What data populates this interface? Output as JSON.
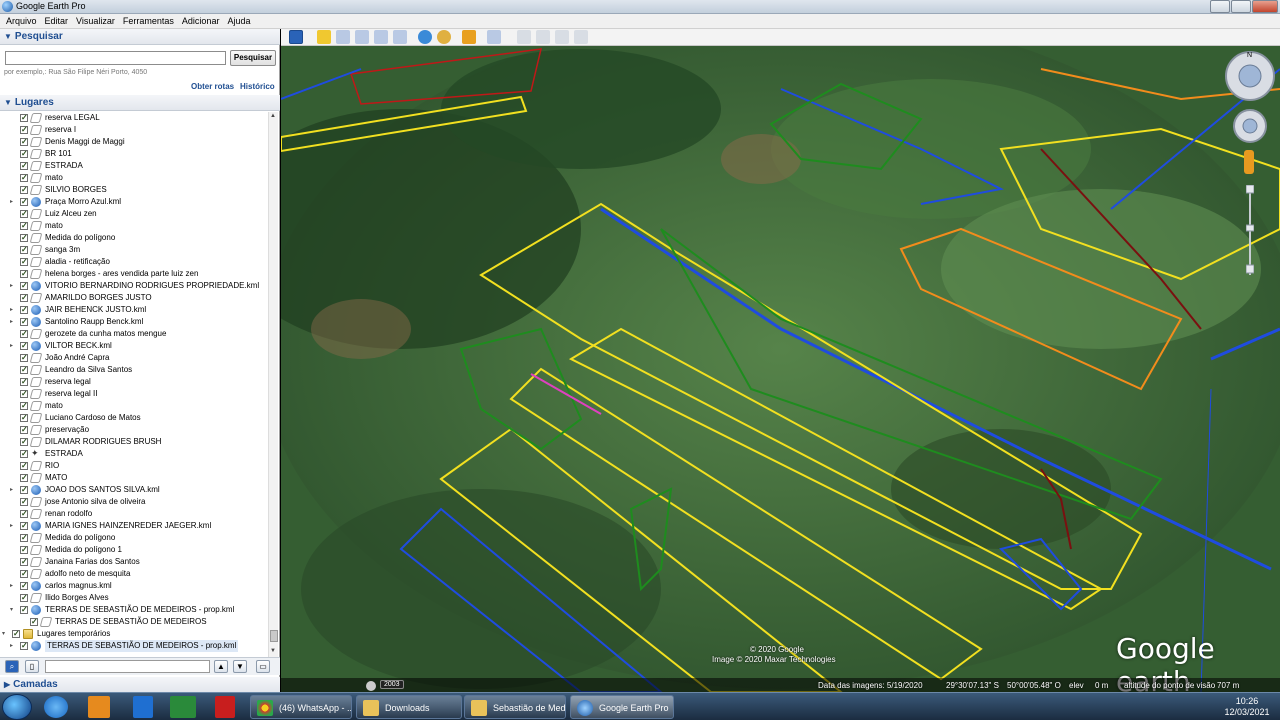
{
  "window": {
    "title": "Google Earth Pro",
    "app_icon": "google-earth-icon"
  },
  "menu": [
    "Arquivo",
    "Editar",
    "Visualizar",
    "Ferramentas",
    "Adicionar",
    "Ajuda"
  ],
  "search": {
    "header": "Pesquisar",
    "value": "",
    "button": "Pesquisar",
    "hint": "por exemplo,: Rua São Filipe Néri Porto, 4050",
    "link_routes": "Obter rotas",
    "link_history": "Histórico"
  },
  "places": {
    "header": "Lugares",
    "items": [
      {
        "label": "reserva LEGAL",
        "icon": "path",
        "exp": ""
      },
      {
        "label": "reserva I",
        "icon": "path",
        "exp": ""
      },
      {
        "label": "Denis Maggi de Maggi",
        "icon": "path",
        "exp": ""
      },
      {
        "label": "BR 101",
        "icon": "path",
        "exp": ""
      },
      {
        "label": "ESTRADA",
        "icon": "path",
        "exp": ""
      },
      {
        "label": "mato",
        "icon": "path",
        "exp": ""
      },
      {
        "label": "SILVIO BORGES",
        "icon": "path",
        "exp": ""
      },
      {
        "label": "Praça Morro Azul.kml",
        "icon": "globe",
        "exp": "▸"
      },
      {
        "label": "Luiz Alceu zen",
        "icon": "path",
        "exp": ""
      },
      {
        "label": "mato",
        "icon": "path",
        "exp": ""
      },
      {
        "label": "Medida do polígono",
        "icon": "path",
        "exp": ""
      },
      {
        "label": "sanga 3m",
        "icon": "path",
        "exp": ""
      },
      {
        "label": "aladia - retificação",
        "icon": "path",
        "exp": ""
      },
      {
        "label": "helena borges - ares vendida parte luiz zen",
        "icon": "path",
        "exp": ""
      },
      {
        "label": "VITORIO BERNARDINO RODRIGUES PROPRIEDADE.kml",
        "icon": "globe",
        "exp": "▸"
      },
      {
        "label": "AMARILDO BORGES JUSTO",
        "icon": "path",
        "exp": ""
      },
      {
        "label": "JAIR BEHENCK JUSTO.kml",
        "icon": "globe",
        "exp": "▸"
      },
      {
        "label": "Santolino Raupp Benck.kml",
        "icon": "globe",
        "exp": "▸"
      },
      {
        "label": "gerozete da cunha matos mengue",
        "icon": "path",
        "exp": ""
      },
      {
        "label": "VILTOR BECK.kml",
        "icon": "globe",
        "exp": "▸"
      },
      {
        "label": "João André Capra",
        "icon": "path",
        "exp": ""
      },
      {
        "label": "Leandro da Silva Santos",
        "icon": "path",
        "exp": ""
      },
      {
        "label": "reserva legal",
        "icon": "path",
        "exp": ""
      },
      {
        "label": "reserva legal II",
        "icon": "path",
        "exp": ""
      },
      {
        "label": "mato",
        "icon": "path",
        "exp": ""
      },
      {
        "label": "Luciano Cardoso de Matos",
        "icon": "path",
        "exp": ""
      },
      {
        "label": "preservação",
        "icon": "path",
        "exp": ""
      },
      {
        "label": "DILAMAR RODRIGUES BRUSH",
        "icon": "path",
        "exp": ""
      },
      {
        "label": "ESTRADA",
        "icon": "pin",
        "exp": ""
      },
      {
        "label": "RIO",
        "icon": "path",
        "exp": ""
      },
      {
        "label": "MATO",
        "icon": "path",
        "exp": ""
      },
      {
        "label": "JOAO DOS SANTOS SILVA.kml",
        "icon": "globe",
        "exp": "▸"
      },
      {
        "label": "jose Antonio silva de oliveira",
        "icon": "path",
        "exp": ""
      },
      {
        "label": "renan rodolfo",
        "icon": "path",
        "exp": ""
      },
      {
        "label": "MARIA IGNES HAINZENREDER JAEGER.kml",
        "icon": "globe",
        "exp": "▸"
      },
      {
        "label": "Medida do polígono",
        "icon": "path",
        "exp": ""
      },
      {
        "label": "Medida do polígono 1",
        "icon": "path",
        "exp": ""
      },
      {
        "label": "Janaina Farias dos Santos",
        "icon": "path",
        "exp": ""
      },
      {
        "label": "adolfo neto de mesquita",
        "icon": "path",
        "exp": ""
      },
      {
        "label": "carlos magnus.kml",
        "icon": "globe",
        "exp": "▸"
      },
      {
        "label": "Ilido Borges Alves",
        "icon": "path",
        "exp": ""
      },
      {
        "label": "TERRAS DE SEBASTIÃO DE MEDEIROS - prop.kml",
        "icon": "globe",
        "exp": "▾"
      },
      {
        "label": "TERRAS DE SEBASTIÃO DE MEDEIROS",
        "icon": "path",
        "exp": "",
        "indent": 1
      },
      {
        "label": "Lugares temporários",
        "icon": "folder",
        "exp": "▾",
        "indent": -1
      },
      {
        "label": "TERRAS DE SEBASTIÃO DE MEDEIROS - prop.kml",
        "icon": "globe",
        "exp": "▸",
        "selected": true
      }
    ]
  },
  "layers_header": "Camadas",
  "map": {
    "copyright_1": "© 2020 Google",
    "copyright_2": "Image © 2020 Maxar Technologies",
    "logo": "Google earth",
    "year": "2003",
    "status": {
      "imagery_date": "Data das imagens: 5/19/2020",
      "lat": "29°30'07.13\" S",
      "lon": "50°00'05.48\" O",
      "elev_label": "elev",
      "elev": "0 m",
      "eye_alt_label": "altitude do ponto de visão",
      "eye_alt": "707 m"
    },
    "compass": "N"
  },
  "taskbar": {
    "tasks": [
      {
        "label": "(46) WhatsApp - ...",
        "icon": "chrome-icon"
      },
      {
        "label": "Downloads",
        "icon": "folder-icon"
      },
      {
        "label": "Sebastião de Med...",
        "icon": "folder-icon"
      },
      {
        "label": "Google Earth Pro",
        "icon": "google-earth-icon",
        "active": true
      }
    ],
    "time": "10:26",
    "date": "12/03/2021"
  }
}
